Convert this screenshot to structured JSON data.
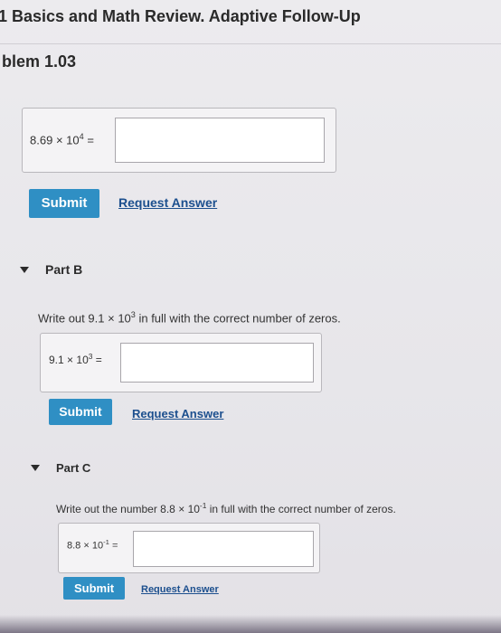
{
  "header": {
    "title": "1 Basics and Math Review. Adaptive Follow-Up",
    "problem": "blem 1.03"
  },
  "part_a": {
    "mantissa": "8.69",
    "exponent": "4",
    "submit_label": "Submit",
    "request_label": "Request Answer",
    "input_value": ""
  },
  "part_b": {
    "title": "Part B",
    "instruction_prefix": "Write out 9.1",
    "instruction_exponent": "3",
    "instruction_suffix": "in full with the correct number of zeros.",
    "mantissa": "9.1",
    "exponent": "3",
    "submit_label": "Submit",
    "request_label": "Request Answer",
    "input_value": ""
  },
  "part_c": {
    "title": "Part C",
    "instruction_prefix": "Write out the number 8.8",
    "instruction_exponent": "-1",
    "instruction_suffix": "in full with the correct number of zeros.",
    "mantissa": "8.8",
    "exponent": "-1",
    "submit_label": "Submit",
    "request_label": "Request Answer",
    "input_value": ""
  },
  "symbols": {
    "times": "×",
    "ten": "10",
    "equals": "="
  },
  "colors": {
    "submit_bg": "#2f8fc4",
    "link": "#1c4f8e"
  }
}
